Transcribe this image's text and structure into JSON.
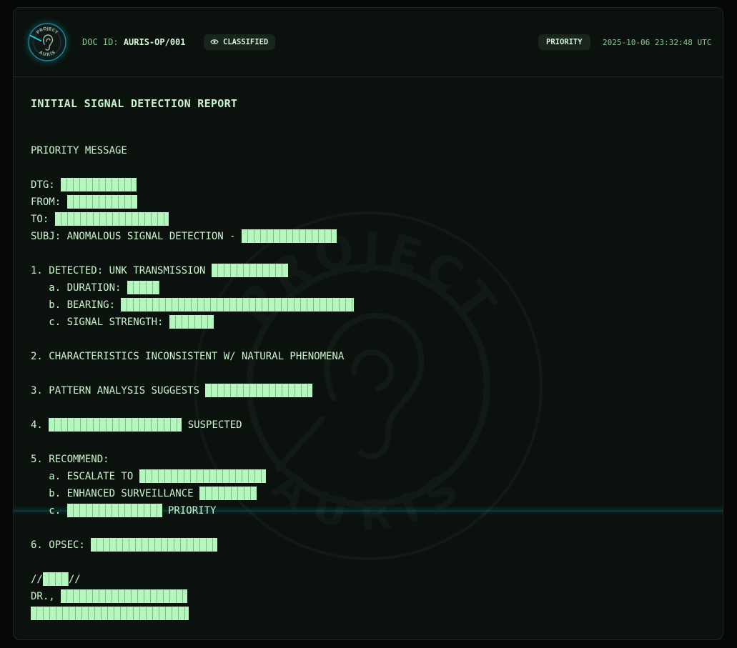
{
  "header": {
    "logo_top": "PROJECT",
    "logo_bottom": "AURIS",
    "doc_id_label": "DOC ID:",
    "doc_id_value": "AURIS-OP/001",
    "classified_label": "CLASSIFIED",
    "priority_label": "PRIORITY",
    "timestamp": "2025-10-06 23:32:48 UTC"
  },
  "watermark": {
    "top_text": "PROJECT",
    "bottom_text": "AURIS"
  },
  "report": {
    "title": "INITIAL SIGNAL DETECTION REPORT",
    "message_type": "PRIORITY MESSAGE",
    "dtg_label": "DTG: ",
    "from_label": "FROM: ",
    "to_label": "TO: ",
    "subj_label": "SUBJ: ANOMALOUS SIGNAL DETECTION - ",
    "item1": "1. DETECTED: UNK TRANSMISSION ",
    "item1a": "   a. DURATION: ",
    "item1b": "   b. BEARING: ",
    "item1c": "   c. SIGNAL STRENGTH: ",
    "item2": "2. CHARACTERISTICS INCONSISTENT W/ NATURAL PHENOMENA",
    "item3": "3. PATTERN ANALYSIS SUGGESTS ",
    "item4_prefix": "4. ",
    "item4_suffix": " SUSPECTED",
    "item5": "5. RECOMMEND:",
    "item5a": "   a. ESCALATE TO ",
    "item5b": "   b. ENHANCED SURVEILLANCE ",
    "item5c_prefix": "   c. ",
    "item5c_suffix": " PRIORITY",
    "item6": "6. OPSEC: ",
    "sig_open": "//",
    "sig_close": "//",
    "sig_dr": "DR., "
  },
  "colors": {
    "background": "#050806",
    "panel": "#0b110d",
    "text_green": "#c9f5cd",
    "redaction": "#b6f7bf",
    "accent_cyan": "#00d8f0"
  }
}
